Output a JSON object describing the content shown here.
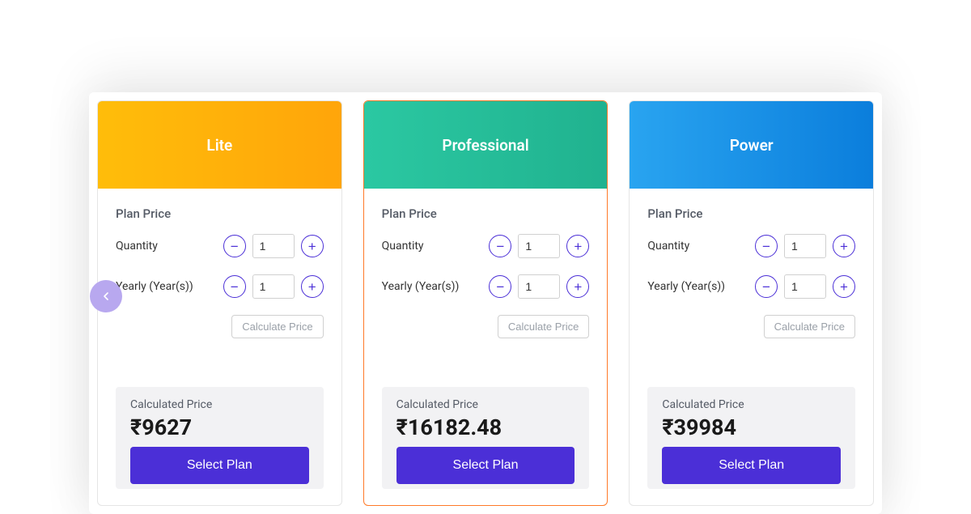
{
  "labels": {
    "plan_price": "Plan Price",
    "quantity": "Quantity",
    "yearly": "Yearly (Year(s))",
    "calculate": "Calculate Price",
    "calculated_price": "Calculated Price",
    "select_plan": "Select Plan"
  },
  "plans": [
    {
      "id": "lite",
      "name": "Lite",
      "quantity": "1",
      "years": "1",
      "price": "₹9627",
      "highlighted": false,
      "header_class": "hdr-lite"
    },
    {
      "id": "professional",
      "name": "Professional",
      "quantity": "1",
      "years": "1",
      "price": "₹16182.48",
      "highlighted": true,
      "header_class": "hdr-pro"
    },
    {
      "id": "power",
      "name": "Power",
      "quantity": "1",
      "years": "1",
      "price": "₹39984",
      "highlighted": false,
      "header_class": "hdr-pow"
    }
  ]
}
